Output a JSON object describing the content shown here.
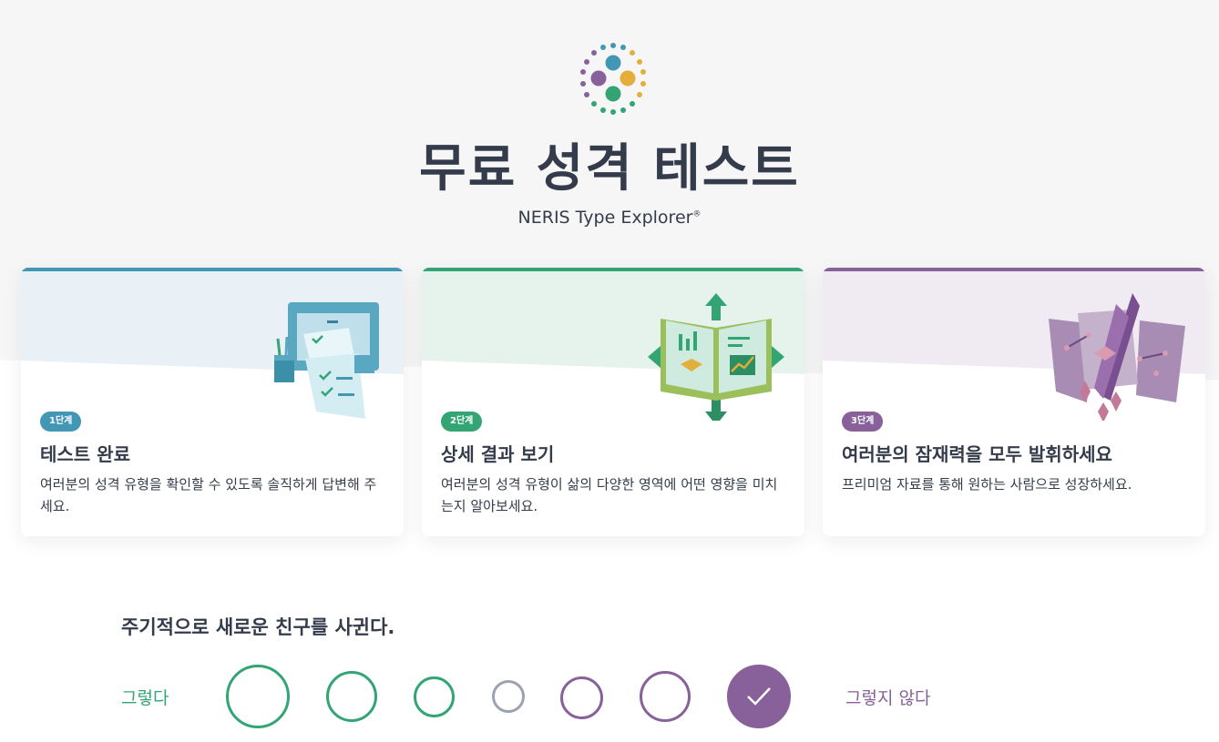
{
  "header": {
    "title": "무료 성격 테스트",
    "subtitle": "NERIS Type Explorer",
    "registered_mark": "®"
  },
  "colors": {
    "blue": "#4298b4",
    "green": "#33a474",
    "purple": "#88619a",
    "yellow": "#e4ae3a",
    "text": "#343c4b",
    "neutral": "#9ca3af"
  },
  "steps": [
    {
      "badge": "1단계",
      "title": "테스트 완료",
      "description": "여러분의 성격 유형을 확인할 수 있도록 솔직하게 답변해 주세요.",
      "icon": "checklist-icon"
    },
    {
      "badge": "2단계",
      "title": "상세 결과 보기",
      "description": "여러분의 성격 유형이 삶의 다양한 영역에 어떤 영향을 미치는지 알아보세요.",
      "icon": "book-chart-icon"
    },
    {
      "badge": "3단계",
      "title": "여러분의 잠재력을 모두 발휘하세요",
      "description": "프리미엄 자료를 통해 원하는 사람으로 성장하세요.",
      "icon": "crystals-icon"
    }
  ],
  "question": {
    "text": "주기적으로 새로운 친구를 사귄다.",
    "agree_label": "그렇다",
    "disagree_label": "그렇지 않다",
    "options_count": 7,
    "selected_index": 6
  }
}
